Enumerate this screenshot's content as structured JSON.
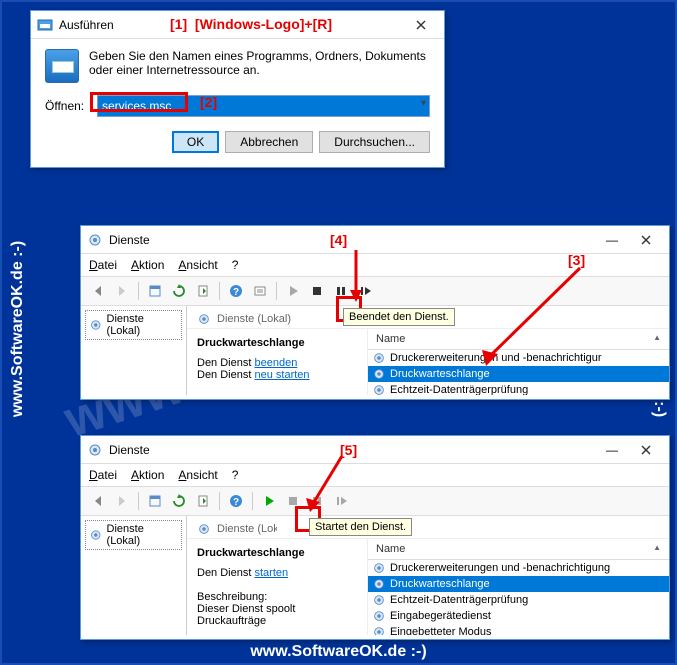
{
  "annotations": {
    "a1": "[1]",
    "a1_text": "[Windows-Logo]+[R]",
    "a2": "[2]",
    "a3": "[3]",
    "a4": "[4]",
    "a5": "[5]"
  },
  "watermark": "www.SoftwareOK.de :-)",
  "run": {
    "title": "Ausführen",
    "hint": "Geben Sie den Namen eines Programms, Ordners, Dokuments oder einer Internetressource an.",
    "open_label": "Öffnen:",
    "value": "services.msc",
    "ok": "OK",
    "cancel": "Abbrechen",
    "browse": "Durchsuchen..."
  },
  "services": {
    "title": "Dienste",
    "menu": {
      "file": "Datei",
      "action": "Aktion",
      "view": "Ansicht",
      "help": "?"
    },
    "left_panel": "Dienste (Lokal)",
    "right_head": "Dienste (Lokal)",
    "col_name": "Name",
    "tooltip_stop": "Beendet den Dienst.",
    "tooltip_start": "Startet den Dienst.",
    "detail1": {
      "name": "Druckwarteschlange",
      "line1_pre": "Den Dienst ",
      "line1_link": "beenden",
      "line2_pre": "Den Dienst ",
      "line2_link": "neu starten"
    },
    "detail2": {
      "name": "Druckwarteschlange",
      "line1_pre": "Den Dienst ",
      "line1_link": "starten",
      "desc_label": "Beschreibung:",
      "desc_text": "Dieser Dienst spoolt Druckaufträge"
    },
    "items1": [
      "Druckererweiterungen und -benachrichtigur",
      "Druckwarteschlange",
      "Echtzeit-Datenträgerprüfung"
    ],
    "items2": [
      "Druckererweiterungen und -benachrichtigung",
      "Druckwarteschlange",
      "Echtzeit-Datenträgerprüfung",
      "Eingabegerätedienst",
      "Eingebetteter Modus"
    ]
  }
}
